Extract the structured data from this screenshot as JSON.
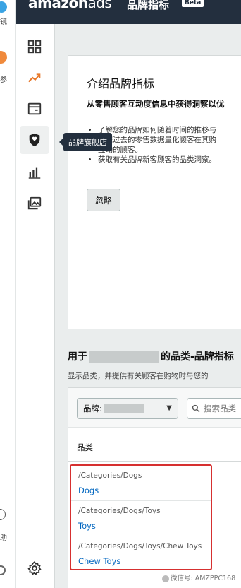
{
  "sliver": {
    "top_label": "镜",
    "mid_label": "参",
    "bottom_label": "助"
  },
  "header": {
    "logo_main": "amazon",
    "logo_suffix": "ads",
    "title": "品牌指标",
    "badge": "Beta"
  },
  "nav": {
    "items": [
      {
        "name": "dashboard-icon"
      },
      {
        "name": "trend-icon"
      },
      {
        "name": "storefront-icon"
      },
      {
        "name": "shield-icon",
        "active": true
      },
      {
        "name": "bar-chart-icon"
      },
      {
        "name": "media-icon"
      },
      {
        "name": "gear-icon"
      }
    ],
    "tooltip": "品牌旗舰店"
  },
  "intro": {
    "title": "介绍品牌指标",
    "subtitle": "从零售顾客互动度信息中获得洞察以优",
    "bullets": [
      "了解您的品牌如何随着时间的推移与",
      "根据过去的零售数据量化顾客在其购",
      "互动的顾客。",
      "获取有关品牌新客顾客的品类洞察。"
    ],
    "dismiss_label": "忽略"
  },
  "section": {
    "title_prefix": "用于",
    "title_suffix": "的品类-品牌指标",
    "description": "显示品类，并提供有关顾客在购物时与您的"
  },
  "filters": {
    "brand_label": "品牌:",
    "search_placeholder": "搜索品类"
  },
  "table": {
    "column_header": "品类",
    "rows": [
      {
        "path": "/Categories/Dogs",
        "name": "Dogs"
      },
      {
        "path": "/Categories/Dogs/Toys",
        "name": "Toys"
      },
      {
        "path": "/Categories/Dogs/Toys/Chew Toys",
        "name": "Chew Toys"
      }
    ]
  },
  "watermark": "微信号: AMZPPC168",
  "colors": {
    "header_bg": "#232f3e",
    "link": "#0066c0",
    "highlight": "#d63030"
  }
}
